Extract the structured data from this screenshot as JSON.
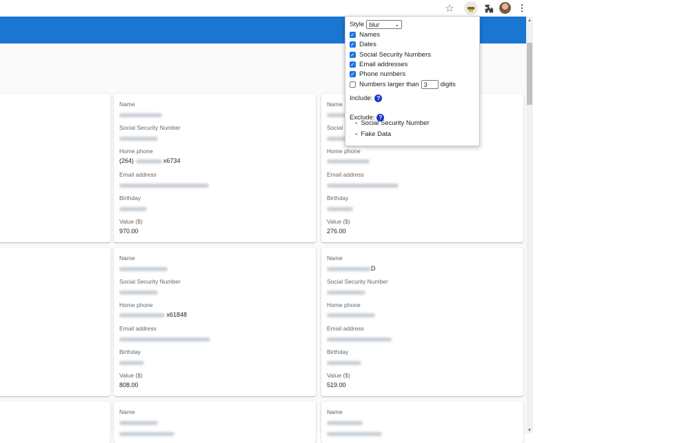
{
  "toolbar": {
    "icons": [
      "star-icon",
      "extension-active-icon",
      "puzzle-icon",
      "avatar",
      "menu-icon"
    ],
    "star_glyph": "☆",
    "menu_glyph": "⋮"
  },
  "colors": {
    "app_bar": "#1976d2",
    "checkbox_checked": "#1a73e8",
    "help_icon": "#1a35c8",
    "exclude_marker": "#dd0000"
  },
  "popup": {
    "style_label": "Style",
    "style_value": "blur",
    "options": [
      {
        "label": "Names",
        "checked": true
      },
      {
        "label": "Dates",
        "checked": true
      },
      {
        "label": "Social Security Numbers",
        "checked": true
      },
      {
        "label": "Email addresses",
        "checked": true
      },
      {
        "label": "Phone numbers",
        "checked": true
      }
    ],
    "numbers_label": "Numbers larger than",
    "numbers_value": "3",
    "numbers_suffix": "digits",
    "numbers_checked": false,
    "include_label": "Include:",
    "exclude_label": "Exclude:",
    "exclude_items": [
      "Social Security Number",
      "Fake Data"
    ],
    "help_glyph": "?"
  },
  "labels": {
    "name": "Name",
    "ssn": "Social Security Number",
    "ssn_partial": "Social",
    "phone": "Home phone",
    "email": "Email address",
    "birthday": "Birthday",
    "value": "Value ($)"
  },
  "cards": [
    {
      "phone_prefix": "(264)",
      "phone_ext": "x6734",
      "value": "970.00"
    },
    {
      "value": "276.00"
    },
    {
      "phone_ext": "x61848",
      "value": "808.00"
    },
    {
      "name_suffix": "D",
      "value": "519.00"
    }
  ]
}
